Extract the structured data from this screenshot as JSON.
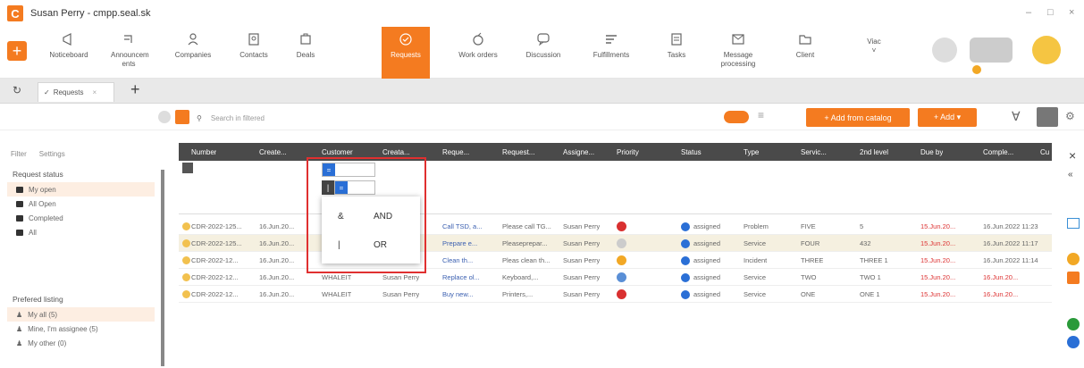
{
  "window": {
    "title": "Susan Perry - cmpp.seal.sk",
    "minimize": "–",
    "maximize": "□",
    "close": "×"
  },
  "toolbar": {
    "items": [
      {
        "label": "Noticeboard",
        "icon": "megaphone-icon"
      },
      {
        "label": "Announcem ents",
        "icon": "announcement-icon"
      },
      {
        "label": "Companies",
        "icon": "companies-icon"
      },
      {
        "label": "Contacts",
        "icon": "contacts-icon"
      },
      {
        "label": "Deals",
        "icon": "deals-icon"
      },
      {
        "label": "Requests",
        "icon": "requests-icon"
      },
      {
        "label": "Work orders",
        "icon": "work-orders-icon"
      },
      {
        "label": "Discussion",
        "icon": "discussion-icon"
      },
      {
        "label": "Fulfillments",
        "icon": "fulfillments-icon"
      },
      {
        "label": "Tasks",
        "icon": "tasks-icon"
      },
      {
        "label": "Message processing",
        "icon": "message-icon"
      },
      {
        "label": "Client",
        "icon": "client-icon"
      },
      {
        "label": "Viac",
        "icon": "more-icon"
      }
    ]
  },
  "tabs": {
    "current": "Requests",
    "add": "+"
  },
  "subbar": {
    "search_placeholder": "Search in filtered",
    "add_from_catalog": "+ Add from catalog",
    "add": "+ Add ▾"
  },
  "sidebar": {
    "tab_filter": "Filter",
    "tab_settings": "Settings",
    "request_status_title": "Request status",
    "status_items": [
      "My open",
      "All Open",
      "Completed",
      "All"
    ],
    "preferred_title": "Prefered listing",
    "preferred_items": [
      "My all (5)",
      "Mine, I'm assignee (5)",
      "My other (0)"
    ]
  },
  "grid": {
    "headers": [
      "Number",
      "Create...",
      "Customer",
      "Creata...",
      "Reque...",
      "Request...",
      "Assigne...",
      "Priority",
      "Status",
      "Type",
      "Servic...",
      "2nd level",
      "Due by",
      "Comple...",
      "Cu"
    ],
    "rows": [
      [
        "CDR-2022-125...",
        "16.Jun.20...",
        "",
        "",
        "Call TSD, a...",
        "Please call TG...",
        "Susan Perry",
        "",
        "assigned",
        "Problem",
        "FIVE",
        "5",
        "15.Jun.20...",
        "16.Jun.2022 11:23"
      ],
      [
        "CDR-2022-125...",
        "16.Jun.20...",
        "",
        "",
        "Prepare e...",
        "Pleaseprepar...",
        "Susan Perry",
        "",
        "assigned",
        "Service",
        "FOUR",
        "432",
        "15.Jun.20...",
        "16.Jun.2022 11:17"
      ],
      [
        "CDR-2022-12...",
        "16.Jun.20...",
        "",
        "",
        "Clean th...",
        "Pleas clean th...",
        "Susan Perry",
        "",
        "assigned",
        "Incident",
        "THREE",
        "THREE 1",
        "15.Jun.20...",
        "16.Jun.2022 11:14"
      ],
      [
        "CDR-2022-12...",
        "16.Jun.20...",
        "WHALEIT",
        "Susan Perry",
        "Replace ol...",
        "Keyboard,...",
        "Susan Perry",
        "",
        "assigned",
        "Service",
        "TWO",
        "TWO 1",
        "15.Jun.20...",
        "16.Jun.20..."
      ],
      [
        "CDR-2022-12...",
        "16.Jun.20...",
        "WHALEIT",
        "Susan Perry",
        "Buy new...",
        "Printers,...",
        "Susan Perry",
        "",
        "assigned",
        "Service",
        "ONE",
        "ONE 1",
        "15.Jun.20...",
        "16.Jun.20..."
      ]
    ],
    "priority_colors": [
      "#d93030",
      "#cccccc",
      "#f2a825",
      "#5a8fd6",
      "#d93030"
    ]
  },
  "popup": {
    "items": [
      {
        "sym": "&",
        "label": "AND"
      },
      {
        "sym": "|",
        "label": "OR"
      }
    ]
  },
  "filter_input": {
    "operator": "|"
  }
}
